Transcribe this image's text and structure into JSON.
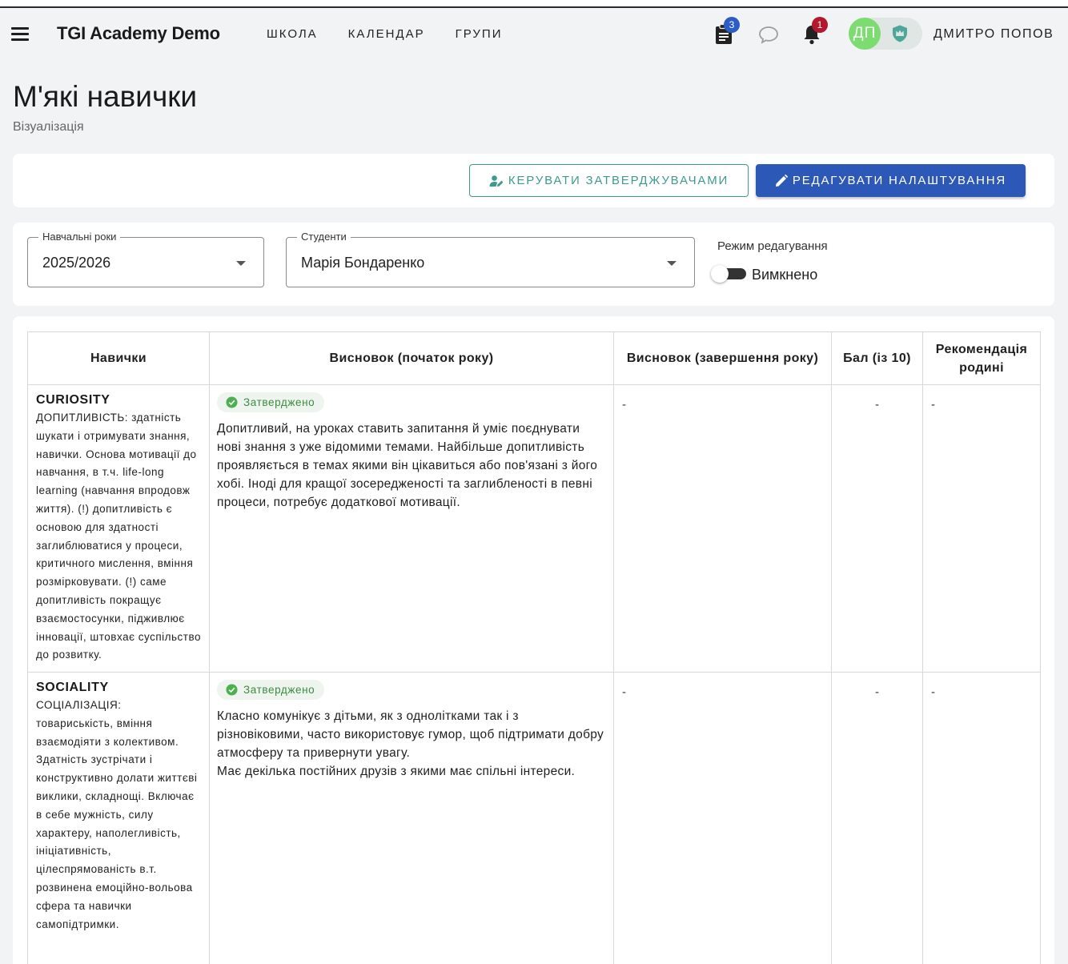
{
  "app": {
    "title": "TGI Academy Demo",
    "nav": [
      "ШКОЛА",
      "КАЛЕНДАР",
      "ГРУПИ"
    ],
    "tasks_badge": "3",
    "notifications_badge": "1",
    "avatar_initials": "ДП",
    "user_name": "ДМИТРО ПОПОВ"
  },
  "page": {
    "title": "М'які навички",
    "subtitle": "Візуалізація"
  },
  "actions": {
    "manage_approvers": "КЕРУВАТИ ЗАТВЕРДЖУВАЧАМИ",
    "edit_settings": "РЕДАГУВАТИ НАЛАШТУВАННЯ"
  },
  "filters": {
    "year_label": "Навчальні роки",
    "year_value": "2025/2026",
    "student_label": "Студенти",
    "student_value": "Марія Бондаренко",
    "edit_mode_label": "Режим редагування",
    "edit_mode_value": "Вимкнено"
  },
  "table": {
    "headers": [
      "Навички",
      "Висновок (початок року)",
      "Висновок (завершення року)",
      "Бал (із 10)",
      "Рекомендація родині"
    ],
    "rows": [
      {
        "skill": "CURIOSITY",
        "description": "ДОПИТЛИВІСТЬ: здатність шукати і отримувати знання, навички. Основа мотивації до навчання, в т.ч. life-long learning (навчання впродовж життя). (!) допитливість є основою для здатності заглиблюватися у процеси, критичного мислення, вміння розмірковувати. (!) саме допитливість покращує взаємостосунки, підживлює інновації, штовхає суспільство до розвитку.",
        "status": "Затверджено",
        "conclusion_start": "Допитливий, на уроках ставить запитання й уміє поєднувати нові знання з уже відомими темами. Найбільше допитливість проявляється в темах якими він цікавиться або пов'язані з його хобі.  Іноді для кращої зосередженості та заглибленості в певні процеси, потребує додаткової мотивації.",
        "conclusion_end": "-",
        "score": "-",
        "recommendation": "-"
      },
      {
        "skill": "SOCIALITY",
        "description": "СОЦІАЛІЗАЦІЯ: товариськість, вміння взаємодіяти з колективом. Здатність зустрічати і конструктивно долати життєві виклики, складнощі. Включає в себе мужність, силу характеру, наполегливість, ініціативність, цілеспрямованість в.т. розвинена емоційно-вольова сфера та навички самопідтримки.",
        "status": "Затверджено",
        "conclusion_start": "Класно комунікує з дітьми, як з однолітками так і з різновіковими, часто використовує гумор, щоб підтримати добру атмосферу та привернути увагу.\nМає декілька постійних друзів з якими має спільні інтереси.",
        "conclusion_end": "-",
        "score": "-",
        "recommendation": "-"
      }
    ]
  }
}
